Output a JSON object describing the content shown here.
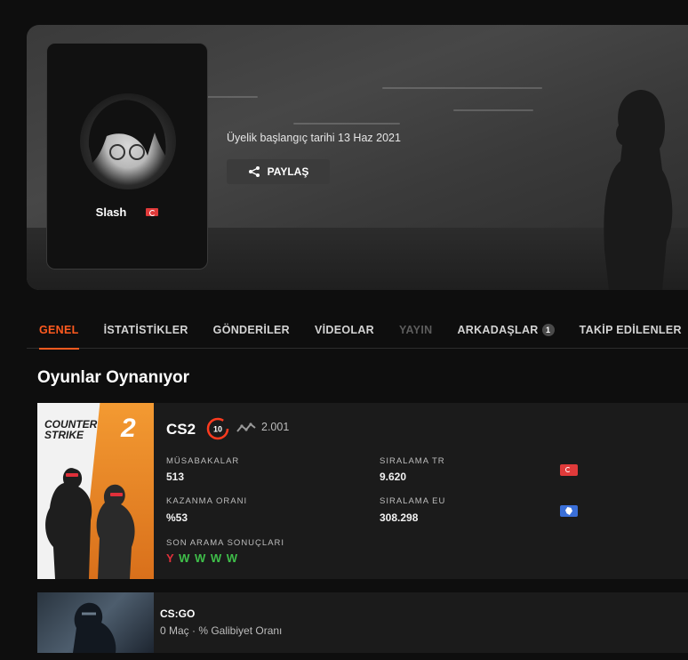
{
  "profile": {
    "username": "Slash",
    "country_flag": "turkey-flag",
    "member_since": "Üyelik başlangıç tarihi 13 Haz 2021",
    "share_label": "PAYLAŞ"
  },
  "tabs": [
    {
      "label": "GENEL",
      "state": "active"
    },
    {
      "label": "İSTATİSTİKLER",
      "state": "normal"
    },
    {
      "label": "GÖNDERİLER",
      "state": "normal"
    },
    {
      "label": "VİDEOLAR",
      "state": "normal"
    },
    {
      "label": "YAYIN",
      "state": "disabled"
    },
    {
      "label": "ARKADAŞLAR",
      "state": "normal",
      "badge": "1"
    },
    {
      "label": "TAKİP EDİLENLER",
      "state": "normal"
    }
  ],
  "section_title": "Oyunlar Oynanıyor",
  "cs2": {
    "title": "CS2",
    "level": "10",
    "elo": "2.001",
    "cover_text": "COUNTER STRIKE",
    "cover_number": "2",
    "matches_label": "MÜSABAKALAR",
    "matches_value": "513",
    "winrate_label": "KAZANMA ORANI",
    "winrate_value": "%53",
    "rank_tr_label": "SIRALAMA TR",
    "rank_tr_value": "9.620",
    "rank_eu_label": "SIRALAMA EU",
    "rank_eu_value": "308.298",
    "recent_label": "SON ARAMA SONUÇLARI",
    "recent_results": [
      "Y",
      "W",
      "W",
      "W",
      "W"
    ],
    "colors": {
      "loss": "#e0303a",
      "win": "#3fbf4a",
      "accent": "#ff5a1f"
    }
  },
  "csgo": {
    "title": "CS:GO",
    "subtitle": "0 Maç · % Galibiyet Oranı"
  }
}
